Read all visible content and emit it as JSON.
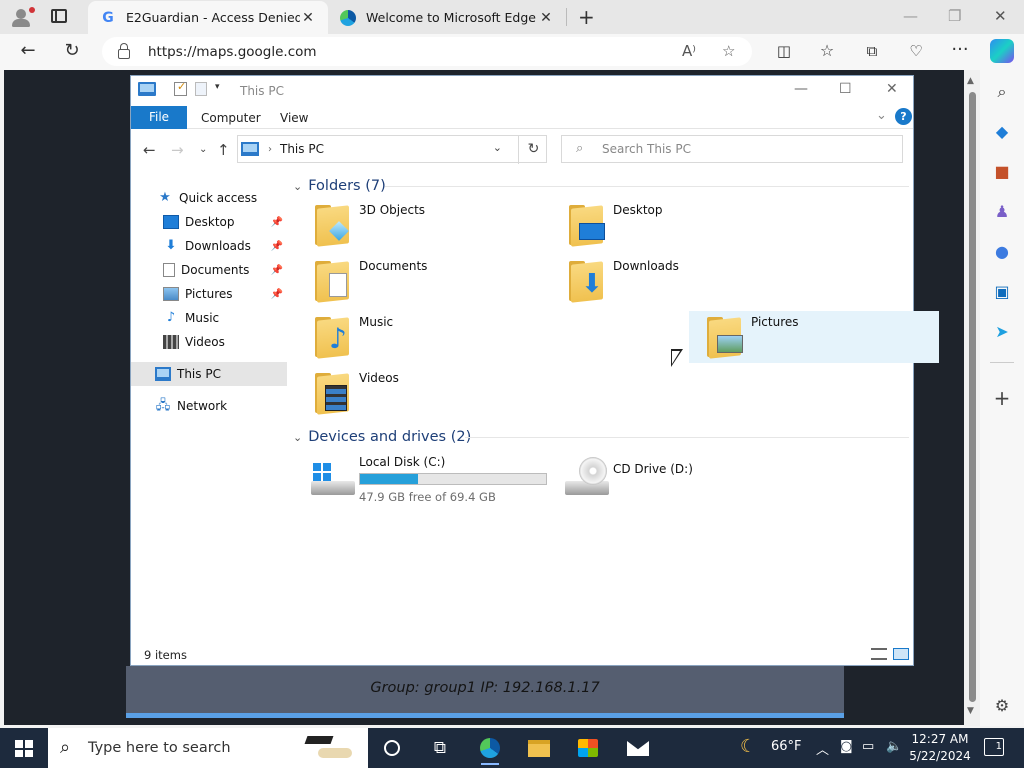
{
  "browser": {
    "tabs": [
      {
        "title": "E2Guardian - Access Denied",
        "favicon": "google-g-icon",
        "active": true
      },
      {
        "title": "Welcome to Microsoft Edge",
        "favicon": "edge-icon",
        "active": false
      }
    ],
    "address": "https://maps.google.com"
  },
  "explorer": {
    "title": "This PC",
    "ribbon_tabs": {
      "file": "File",
      "computer": "Computer",
      "view": "View"
    },
    "help": "?",
    "path": "This PC",
    "search_placeholder": "Search This PC",
    "nav": {
      "quick_access": "Quick access",
      "desktop": "Desktop",
      "downloads": "Downloads",
      "documents": "Documents",
      "pictures": "Pictures",
      "music": "Music",
      "videos": "Videos",
      "this_pc": "This PC",
      "network": "Network"
    },
    "folders_header": "Folders (7)",
    "folders": {
      "objects3d": "3D Objects",
      "desktop": "Desktop",
      "documents": "Documents",
      "downloads": "Downloads",
      "music": "Music",
      "pictures": "Pictures",
      "videos": "Videos"
    },
    "drives_header": "Devices and drives (2)",
    "drives": {
      "c_name": "Local Disk (C:)",
      "c_free": "47.9 GB free of 69.4 GB",
      "c_used_fraction": 0.31,
      "d_name": "CD Drive (D:)"
    },
    "status_items": "9 items"
  },
  "remote_info": "Group: group1    IP: 192.168.1.17",
  "taskbar": {
    "search_placeholder": "Type here to search",
    "weather": "66°F",
    "time": "12:27 AM",
    "date": "5/22/2024",
    "notifications": "1"
  },
  "colors": {
    "explorer_accent": "#1979ca",
    "taskbar_bg": "#1d2a3d",
    "drive_fill": "#26a0da"
  }
}
